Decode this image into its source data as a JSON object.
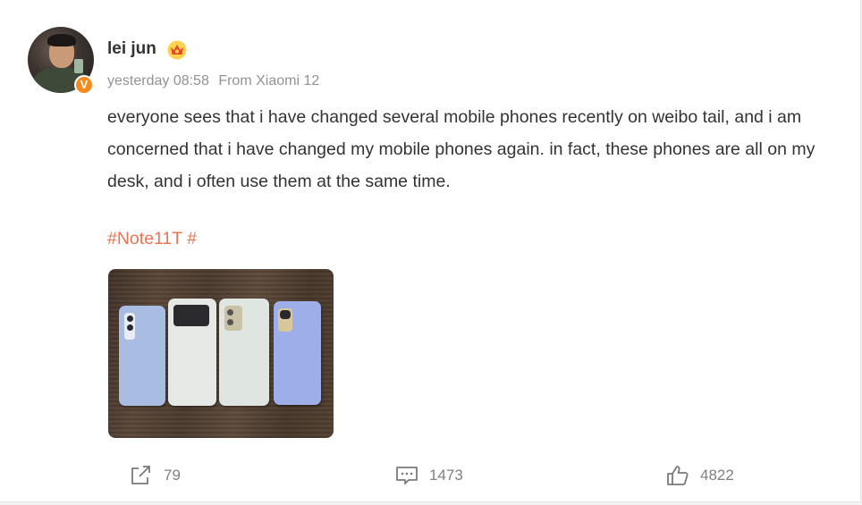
{
  "post": {
    "author": "lei jun",
    "verified_badge": "V",
    "timestamp": "yesterday 08:58",
    "source": "From Xiaomi 12",
    "text": "everyone sees that i have changed several mobile phones recently on weibo tail, and i am concerned that i have changed my mobile phones again. in fact, these phones are all on my desk, and i often use them at the same time.",
    "hashtag": "#Note11T #"
  },
  "actions": {
    "repost_count": "79",
    "comment_count": "1473",
    "like_count": "4822"
  },
  "icons": {
    "crown": "crown-icon",
    "repost": "share-icon",
    "comment": "comment-icon",
    "like": "thumbs-up-icon"
  },
  "colors": {
    "hashtag": "#eb7350",
    "badge": "#f78a1f",
    "text": "#333333",
    "muted": "#939393"
  }
}
